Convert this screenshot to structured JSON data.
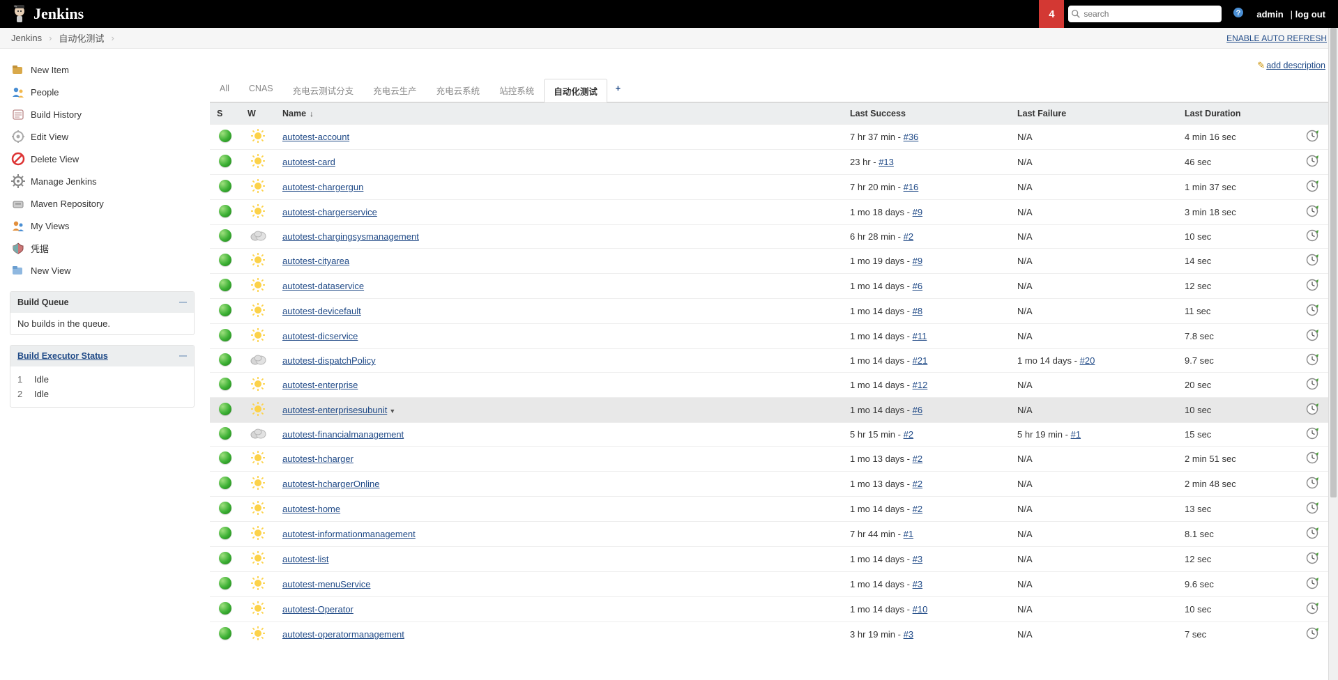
{
  "header": {
    "brand": "Jenkins",
    "notif_count": "4",
    "search_placeholder": "search",
    "user": "admin",
    "logout_sep": "| ",
    "logout": "log out"
  },
  "crumbs": {
    "root": "Jenkins",
    "view": "自动化测试",
    "auto_refresh": "ENABLE AUTO REFRESH"
  },
  "sidebar": {
    "tasks": [
      {
        "label": "New Item",
        "icon": "new-item"
      },
      {
        "label": "People",
        "icon": "people"
      },
      {
        "label": "Build History",
        "icon": "build-history"
      },
      {
        "label": "Edit View",
        "icon": "edit-view"
      },
      {
        "label": "Delete View",
        "icon": "delete-view"
      },
      {
        "label": "Manage Jenkins",
        "icon": "manage"
      },
      {
        "label": "Maven Repository",
        "icon": "maven"
      },
      {
        "label": "My Views",
        "icon": "my-views"
      },
      {
        "label": "凭据",
        "icon": "credentials"
      },
      {
        "label": "New View",
        "icon": "new-view"
      }
    ],
    "queue_title": "Build Queue",
    "queue_empty": "No builds in the queue.",
    "exec_title": "Build Executor Status",
    "executors": [
      {
        "num": "1",
        "state": "Idle"
      },
      {
        "num": "2",
        "state": "Idle"
      }
    ]
  },
  "content": {
    "add_description": "add description",
    "tabs": [
      {
        "label": "All",
        "active": false
      },
      {
        "label": "CNAS",
        "active": false
      },
      {
        "label": "充电云测试分支",
        "active": false
      },
      {
        "label": "充电云生产",
        "active": false
      },
      {
        "label": "充电云系统",
        "active": false
      },
      {
        "label": "站控系统",
        "active": false
      },
      {
        "label": "自动化测试",
        "active": true
      }
    ],
    "columns": {
      "s": "S",
      "w": "W",
      "name": "Name",
      "last_success": "Last Success",
      "last_failure": "Last Failure",
      "last_duration": "Last Duration"
    },
    "jobs": [
      {
        "name": "autotest-account",
        "weather": "sun",
        "ls_text": "7 hr 37 min - ",
        "ls_build": "#36",
        "lf_text": "N/A",
        "lf_build": "",
        "dur": "4 min 16 sec"
      },
      {
        "name": "autotest-card",
        "weather": "sun",
        "ls_text": "23 hr - ",
        "ls_build": "#13",
        "lf_text": "N/A",
        "lf_build": "",
        "dur": "46 sec"
      },
      {
        "name": "autotest-chargergun",
        "weather": "sun",
        "ls_text": "7 hr 20 min - ",
        "ls_build": "#16",
        "lf_text": "N/A",
        "lf_build": "",
        "dur": "1 min 37 sec"
      },
      {
        "name": "autotest-chargerservice",
        "weather": "sun",
        "ls_text": "1 mo 18 days - ",
        "ls_build": "#9",
        "lf_text": "N/A",
        "lf_build": "",
        "dur": "3 min 18 sec"
      },
      {
        "name": "autotest-chargingsysmanagement",
        "weather": "cloud",
        "ls_text": "6 hr 28 min - ",
        "ls_build": "#2",
        "lf_text": "N/A",
        "lf_build": "",
        "dur": "10 sec"
      },
      {
        "name": "autotest-cityarea",
        "weather": "sun",
        "ls_text": "1 mo 19 days - ",
        "ls_build": "#9",
        "lf_text": "N/A",
        "lf_build": "",
        "dur": "14 sec"
      },
      {
        "name": "autotest-dataservice",
        "weather": "sun",
        "ls_text": "1 mo 14 days - ",
        "ls_build": "#6",
        "lf_text": "N/A",
        "lf_build": "",
        "dur": "12 sec"
      },
      {
        "name": "autotest-devicefault",
        "weather": "sun",
        "ls_text": "1 mo 14 days - ",
        "ls_build": "#8",
        "lf_text": "N/A",
        "lf_build": "",
        "dur": "11 sec"
      },
      {
        "name": "autotest-dicservice",
        "weather": "sun",
        "ls_text": "1 mo 14 days - ",
        "ls_build": "#11",
        "lf_text": "N/A",
        "lf_build": "",
        "dur": "7.8 sec"
      },
      {
        "name": "autotest-dispatchPolicy",
        "weather": "cloud",
        "ls_text": "1 mo 14 days - ",
        "ls_build": "#21",
        "lf_text": "1 mo 14 days - ",
        "lf_build": "#20",
        "dur": "9.7 sec"
      },
      {
        "name": "autotest-enterprise",
        "weather": "sun",
        "ls_text": "1 mo 14 days - ",
        "ls_build": "#12",
        "lf_text": "N/A",
        "lf_build": "",
        "dur": "20 sec"
      },
      {
        "name": "autotest-enterprisesubunit",
        "weather": "sun",
        "ls_text": "1 mo 14 days - ",
        "ls_build": "#6",
        "lf_text": "N/A",
        "lf_build": "",
        "dur": "10 sec",
        "hover": true,
        "caret": true
      },
      {
        "name": "autotest-financialmanagement",
        "weather": "cloud",
        "ls_text": "5 hr 15 min - ",
        "ls_build": "#2",
        "lf_text": "5 hr 19 min - ",
        "lf_build": "#1",
        "dur": "15 sec"
      },
      {
        "name": "autotest-hcharger",
        "weather": "sun",
        "ls_text": "1 mo 13 days - ",
        "ls_build": "#2",
        "lf_text": "N/A",
        "lf_build": "",
        "dur": "2 min 51 sec"
      },
      {
        "name": "autotest-hchargerOnline",
        "weather": "sun",
        "ls_text": "1 mo 13 days - ",
        "ls_build": "#2",
        "lf_text": "N/A",
        "lf_build": "",
        "dur": "2 min 48 sec"
      },
      {
        "name": "autotest-home",
        "weather": "sun",
        "ls_text": "1 mo 14 days - ",
        "ls_build": "#2",
        "lf_text": "N/A",
        "lf_build": "",
        "dur": "13 sec"
      },
      {
        "name": "autotest-informationmanagement",
        "weather": "sun",
        "ls_text": "7 hr 44 min - ",
        "ls_build": "#1",
        "lf_text": "N/A",
        "lf_build": "",
        "dur": "8.1 sec"
      },
      {
        "name": "autotest-list",
        "weather": "sun",
        "ls_text": "1 mo 14 days - ",
        "ls_build": "#3",
        "lf_text": "N/A",
        "lf_build": "",
        "dur": "12 sec"
      },
      {
        "name": "autotest-menuService",
        "weather": "sun",
        "ls_text": "1 mo 14 days - ",
        "ls_build": "#3",
        "lf_text": "N/A",
        "lf_build": "",
        "dur": "9.6 sec"
      },
      {
        "name": "autotest-Operator",
        "weather": "sun",
        "ls_text": "1 mo 14 days - ",
        "ls_build": "#10",
        "lf_text": "N/A",
        "lf_build": "",
        "dur": "10 sec"
      },
      {
        "name": "autotest-operatormanagement",
        "weather": "sun",
        "ls_text": "3 hr 19 min - ",
        "ls_build": "#3",
        "lf_text": "N/A",
        "lf_build": "",
        "dur": "7 sec"
      }
    ]
  }
}
